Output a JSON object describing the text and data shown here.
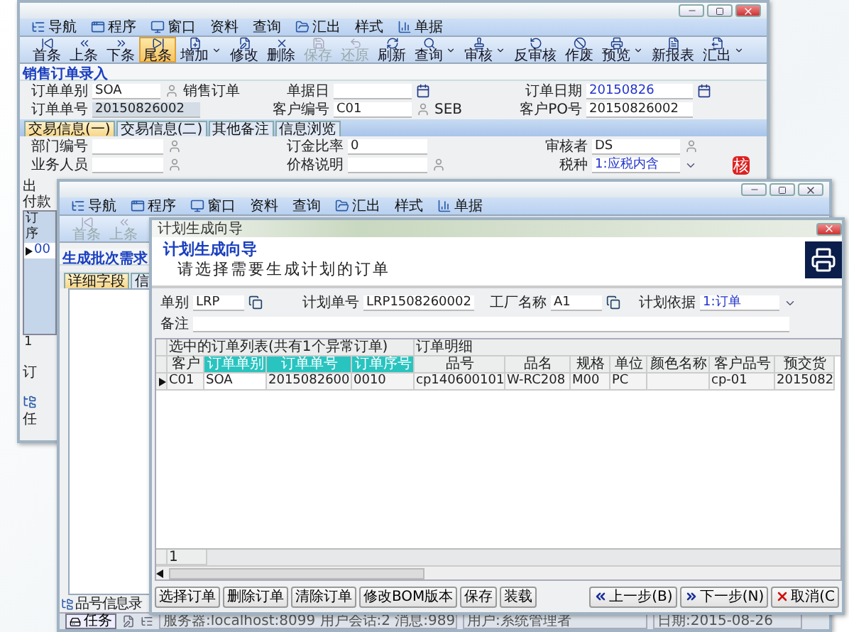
{
  "sales_window": {
    "menu": [
      {
        "label": "导航",
        "has_icon": true
      },
      {
        "label": "程序",
        "has_icon": true
      },
      {
        "label": "窗口",
        "has_icon": true
      },
      {
        "label": "资料",
        "has_icon": false
      },
      {
        "label": "查询",
        "has_icon": false
      },
      {
        "label": "汇出",
        "has_icon": true
      },
      {
        "label": "样式",
        "has_icon": false
      },
      {
        "label": "单据",
        "has_icon": true
      }
    ],
    "toolbar": [
      {
        "label": "首条",
        "selected": false,
        "disabled": false,
        "has_menu": false
      },
      {
        "label": "上条",
        "selected": false,
        "disabled": false,
        "has_menu": false
      },
      {
        "label": "下条",
        "selected": false,
        "disabled": false,
        "has_menu": false
      },
      {
        "label": "尾条",
        "selected": true,
        "disabled": false,
        "has_menu": false
      },
      {
        "label": "增加",
        "selected": false,
        "disabled": false,
        "has_menu": true
      },
      {
        "label": "修改",
        "selected": false,
        "disabled": false,
        "has_menu": false
      },
      {
        "label": "删除",
        "selected": false,
        "disabled": false,
        "has_menu": false
      },
      {
        "label": "保存",
        "selected": false,
        "disabled": true,
        "has_menu": false
      },
      {
        "label": "还原",
        "selected": false,
        "disabled": true,
        "has_menu": false
      },
      {
        "label": "刷新",
        "selected": false,
        "disabled": false,
        "has_menu": false
      },
      {
        "label": "查询",
        "selected": false,
        "disabled": false,
        "has_menu": true
      },
      {
        "label": "审核",
        "selected": false,
        "disabled": false,
        "has_menu": true
      },
      {
        "label": "反审核",
        "selected": false,
        "disabled": false,
        "has_menu": false
      },
      {
        "label": "作废",
        "selected": false,
        "disabled": false,
        "has_menu": false
      },
      {
        "label": "预览",
        "selected": false,
        "disabled": false,
        "has_menu": true
      },
      {
        "label": "新报表",
        "selected": false,
        "disabled": false,
        "has_menu": false
      },
      {
        "label": "汇出",
        "selected": false,
        "disabled": false,
        "has_menu": true
      }
    ],
    "form_title": "销售订单录入",
    "header_rows": [
      [
        {
          "label": "订单单别",
          "value": "SOA",
          "note": "销售订单",
          "kind": "lookup"
        },
        {
          "label": "单据日",
          "kind": "date"
        },
        {
          "label": "订单日期",
          "value": "20150826",
          "kind": "date"
        }
      ],
      [
        {
          "label": "订单单号",
          "value": "20150826002",
          "kind": "readonly"
        },
        {
          "label": "客户编号",
          "value": "C01",
          "note": "SEB",
          "kind": "lookup"
        },
        {
          "label": "客户PO号",
          "value": "20150826002",
          "kind": "text"
        }
      ]
    ],
    "tabs": [
      {
        "label": "交易信息(一)",
        "selected": true
      },
      {
        "label": "交易信息(二)",
        "selected": false
      },
      {
        "label": "其他备注",
        "selected": false
      },
      {
        "label": "信息浏览",
        "selected": false
      }
    ],
    "detail_rows": [
      [
        {
          "label": "部门编号",
          "kind": "lookup"
        },
        {
          "label": "订金比率",
          "value": "0",
          "kind": "number"
        },
        {
          "label": "审核者",
          "value": "DS",
          "kind": "lookup"
        }
      ],
      [
        {
          "label": "业务人员",
          "kind": "lookup"
        },
        {
          "label": "价格说明",
          "kind": "lookup"
        },
        {
          "label": "税种",
          "value": "1:应税内含",
          "kind": "select"
        }
      ]
    ],
    "stamp": "核",
    "side_labels": [
      "出",
      "付款"
    ],
    "grid_header": [
      "订",
      "序"
    ],
    "grid_row": {
      "value": "00",
      "selected": true
    },
    "grid_count": "1",
    "bottom_label": "订",
    "task_label": "任"
  },
  "batch_window": {
    "menu": [
      {
        "label": "导航",
        "has_icon": true
      },
      {
        "label": "程序",
        "has_icon": true
      },
      {
        "label": "窗口",
        "has_icon": true
      },
      {
        "label": "资料",
        "has_icon": false
      },
      {
        "label": "查询",
        "has_icon": false
      },
      {
        "label": "汇出",
        "has_icon": true
      },
      {
        "label": "样式",
        "has_icon": false
      },
      {
        "label": "单据",
        "has_icon": true
      }
    ],
    "toolbar": [
      {
        "label": "首条",
        "selected": false,
        "disabled": true,
        "has_menu": false
      },
      {
        "label": "上条",
        "selected": false,
        "disabled": true,
        "has_menu": false
      }
    ],
    "form_title": "生成批次需求",
    "tabs": [
      {
        "label": "详细字段",
        "selected": true
      },
      {
        "label": "信",
        "selected": false
      }
    ],
    "bottom_tab": "品号信息录",
    "status_bar": {
      "task": "任务",
      "server": "服务器:localhost:8099 用户会话:2 消息:989",
      "user": "用户:系统管理者",
      "date": "日期:2015-08-26"
    }
  },
  "wizard": {
    "title": "计划生成向导",
    "heading": "计划生成向导",
    "subtitle": "请选择需要生成计划的订单",
    "fields": [
      {
        "label": "单别",
        "value": "LRP",
        "kind": "lookup"
      },
      {
        "label": "计划单号",
        "value": "LRP1508260002",
        "kind": "text"
      },
      {
        "label": "工厂名称",
        "value": "A1",
        "kind": "lookup"
      },
      {
        "label": "计划依据",
        "value": "1:订单",
        "kind": "select"
      }
    ],
    "remark": {
      "label": "备注"
    },
    "groups": [
      {
        "label": "选中的订单列表(共有1个异常订单)",
        "columns": [
          {
            "label": "客户",
            "highlight": false
          },
          {
            "label": "订单单别",
            "highlight": true
          },
          {
            "label": "订单单号",
            "highlight": true
          },
          {
            "label": "订单序号",
            "highlight": true
          }
        ]
      },
      {
        "label": "订单明细",
        "columns": [
          {
            "label": "品号",
            "highlight": false
          },
          {
            "label": "品名",
            "highlight": false
          },
          {
            "label": "规格",
            "highlight": false
          },
          {
            "label": "单位",
            "highlight": false
          },
          {
            "label": "颜色名称",
            "highlight": false
          },
          {
            "label": "客户品号",
            "highlight": false
          },
          {
            "label": "预交货",
            "highlight": false
          }
        ]
      }
    ],
    "rows": [
      {
        "selected": true,
        "cells": [
          "C01",
          "SOA",
          "2015082600",
          "0010",
          "cp140600101",
          "W-RC208",
          "M00",
          "PC",
          null,
          "cp-01",
          "2015082"
        ]
      }
    ],
    "row_count": "1",
    "left_buttons": [
      "选择订单",
      "删除订单",
      "清除订单",
      "修改BOM版本",
      "保存",
      "装载"
    ],
    "right_buttons": [
      {
        "label": "上一步(B)",
        "kind": "back"
      },
      {
        "label": "下一步(N)",
        "kind": "next"
      },
      {
        "label": "取消(C",
        "kind": "cancel"
      }
    ]
  }
}
